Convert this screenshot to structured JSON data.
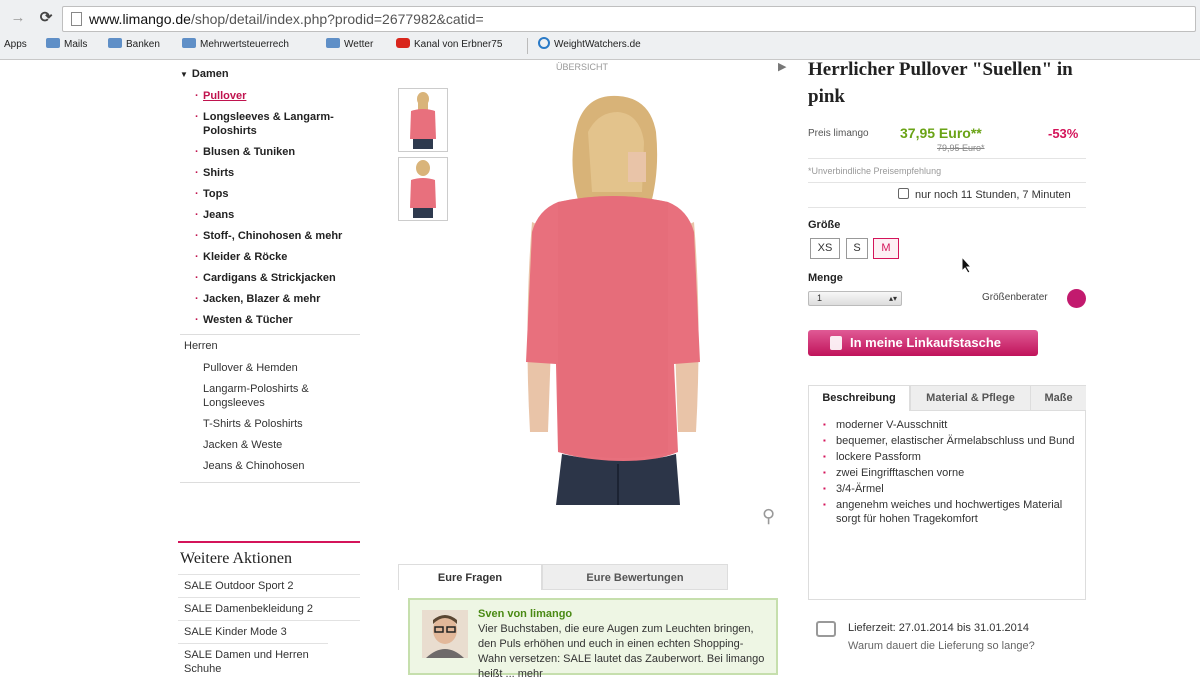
{
  "browser": {
    "url_domain": "www.limango.de",
    "url_path": "/shop/detail/index.php?prodid=2677982&catid=",
    "bookmarks": [
      {
        "label": "Apps",
        "icon": "apps-icon"
      },
      {
        "label": "Mails",
        "icon": "folder-icon"
      },
      {
        "label": "Banken",
        "icon": "folder-icon"
      },
      {
        "label": "Mehrwertsteuerrech",
        "icon": "folder-icon"
      },
      {
        "label": "Wetter",
        "icon": "folder-icon"
      },
      {
        "label": "Kanal von Erbner75",
        "icon": "youtube-icon"
      },
      {
        "label": "WeightWatchers.de",
        "icon": "weightwatchers-icon"
      }
    ]
  },
  "sidebar": {
    "damen_label": "Damen",
    "damen_items": [
      "Pullover",
      "Longsleeves & Langarm-Poloshirts",
      "Blusen & Tuniken",
      "Shirts",
      "Tops",
      "Jeans",
      "Stoff-, Chinohosen & mehr",
      "Kleider & Röcke",
      "Cardigans & Strickjacken",
      "Jacken, Blazer & mehr",
      "Westen & Tücher"
    ],
    "herren_label": "Herren",
    "herren_items": [
      "Pullover & Hemden",
      "Langarm-Poloshirts & Longsleeves",
      "T-Shirts & Poloshirts",
      "Jacken & Weste",
      "Jeans & Chinohosen"
    ]
  },
  "actions": {
    "title": "Weitere Aktionen",
    "items": [
      "SALE Outdoor Sport 2",
      "SALE Damenbekleidung 2",
      "SALE Kinder Mode 3",
      "SALE Damen und Herren Schuhe"
    ]
  },
  "gallery": {
    "overview_label": "ÜBERSICHT"
  },
  "qa": {
    "tabs": [
      "Eure Fragen",
      "Eure Bewertungen"
    ],
    "author": "Sven von limango",
    "text": "Vier Buchstaben, die eure Augen zum Leuchten bringen, den Puls erhöhen und euch in einen echten Shopping-Wahn versetzen: SALE lautet das Zauberwort. Bei limango heißt ... mehr"
  },
  "product": {
    "title": "Herrlicher Pullover \"Suellen\" in pink",
    "price_label": "Preis limango",
    "price": "37,95 Euro**",
    "old_price": "79,95 Euro*",
    "discount": "-53%",
    "uvp_note": "*Unverbindliche Preisempfehlung",
    "timer": "nur noch 11 Stunden, 7 Minuten",
    "size_label": "Größe",
    "sizes": [
      "XS",
      "S",
      "M"
    ],
    "selected_size": "M",
    "qty_label": "Menge",
    "qty_value": "1",
    "size_advisor": "Größenberater",
    "cart_button": "In meine Linkaufstasche",
    "desc_tabs": [
      "Beschreibung",
      "Material & Pflege",
      "Maße"
    ],
    "bullets": [
      "moderner V-Ausschnitt",
      "bequemer, elastischer Ärmelabschluss und Bund",
      "lockere Passform",
      "zwei Eingrifftaschen vorne",
      "3/4-Ärmel",
      "angenehm weiches und hochwertiges Material sorgt für hohen Tragekomfort"
    ],
    "delivery": "Lieferzeit: 27.01.2014 bis 31.01.2014",
    "delivery_link": "Warum dauert die Lieferung so lange?"
  },
  "colors": {
    "accent": "#d4145a",
    "price_green": "#6aa316",
    "sweater_pink": "#e8707d"
  }
}
